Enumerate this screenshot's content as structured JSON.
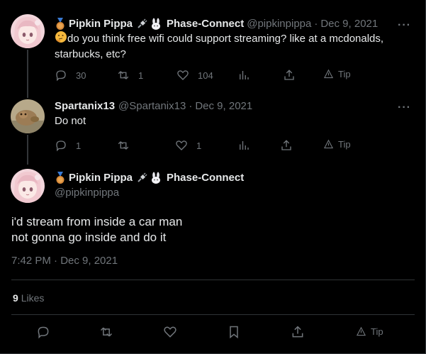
{
  "tweet1": {
    "name": "Pipkin Pippa",
    "name_suffix": "Phase-Connect",
    "handle": "@pipkinpippa",
    "date": "Dec 9, 2021",
    "text_line1": "do you think free wifi could support streaming? like at a mcdonalds,",
    "text_line2": "starbucks, etc?",
    "replies": "30",
    "retweets": "1",
    "likes": "104",
    "tip_label": "Tip"
  },
  "tweet2": {
    "name": "Spartanix13",
    "handle": "@Spartanix13",
    "date": "Dec 9, 2021",
    "text": "Do not",
    "replies": "1",
    "likes": "1",
    "tip_label": "Tip"
  },
  "main": {
    "name": "Pipkin Pippa",
    "name_suffix": "Phase-Connect",
    "handle": "@pipkinpippa",
    "text_line1": "i'd stream from inside a car man",
    "text_line2": "not gonna go inside and do it",
    "timestamp": "7:42 PM · Dec 9, 2021",
    "like_count": "9",
    "like_label": "Likes",
    "tip_label": "Tip"
  },
  "icons": [
    "reply-icon",
    "retweet-icon",
    "like-icon",
    "views-icon",
    "share-icon",
    "tip-icon",
    "bookmark-icon",
    "more-icon"
  ],
  "colors": {
    "background": "#000000",
    "text": "#e7e9ea",
    "muted": "#71767b",
    "divider": "#2f3336",
    "avatar_pink": "#f3d6dc"
  }
}
